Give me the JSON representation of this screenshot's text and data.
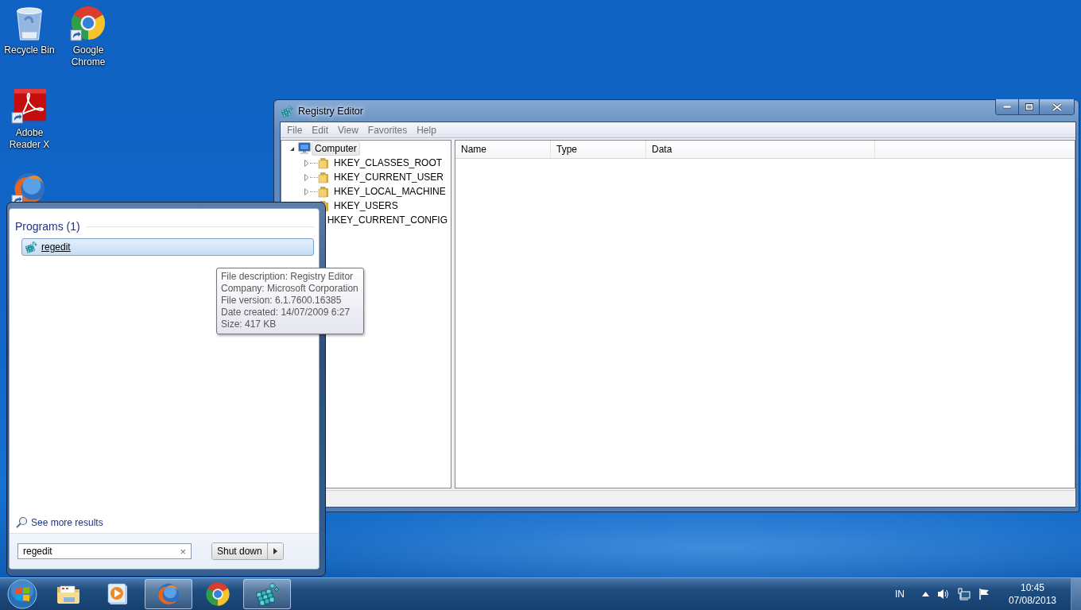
{
  "desktop_icons": [
    {
      "kind": "recycle-bin",
      "label": "Recycle Bin",
      "shortcut": false
    },
    {
      "kind": "pdf-reader",
      "label": "Adobe Reader X",
      "shortcut": true
    },
    {
      "kind": "firefox",
      "shortcut": true
    },
    {
      "kind": "chrome",
      "label": "Google Chrome",
      "shortcut": true
    }
  ],
  "window": {
    "title": "Registry Editor",
    "menu": [
      "File",
      "Edit",
      "View",
      "Favorites",
      "Help"
    ],
    "tree": [
      {
        "label": "Computer",
        "expanded": true,
        "selected": true,
        "children": [
          {
            "label": "HKEY_CLASSES_ROOT",
            "expanded": false,
            "selected": false
          },
          {
            "label": "HKEY_CURRENT_USER",
            "expanded": false,
            "selected": false
          },
          {
            "label": "HKEY_LOCAL_MACHINE",
            "expanded": false,
            "selected": false
          },
          {
            "label": "HKEY_USERS",
            "expanded": false,
            "selected": false
          },
          {
            "label": "HKEY_CURRENT_CONFIG",
            "expanded": false,
            "selected": false
          }
        ]
      }
    ],
    "columns": [
      "Name",
      "Type",
      "Data"
    ]
  },
  "start_menu": {
    "section": "Programs (1)",
    "results": [
      {
        "label": "regedit",
        "selected": true
      }
    ],
    "more_link": "See more results",
    "search": {
      "value": "regedit",
      "clear_button": "×"
    },
    "shutdown": "Shut down"
  },
  "tooltip": {
    "lines": [
      "File description: Registry Editor",
      "Company: Microsoft Corporation",
      "File version: 6.1.7600.16385",
      "Date created: 14/07/2009 6:27",
      "Size: 417 KB"
    ]
  },
  "taskbar": {
    "items": [
      {
        "kind": "explorer",
        "open": false
      },
      {
        "kind": "media-player",
        "open": false
      },
      {
        "kind": "firefox",
        "open": true
      },
      {
        "kind": "chrome",
        "open": false
      },
      {
        "kind": "regedit",
        "open": true
      }
    ],
    "language": "IN",
    "time": "10:45",
    "date": "07/08/2013"
  }
}
